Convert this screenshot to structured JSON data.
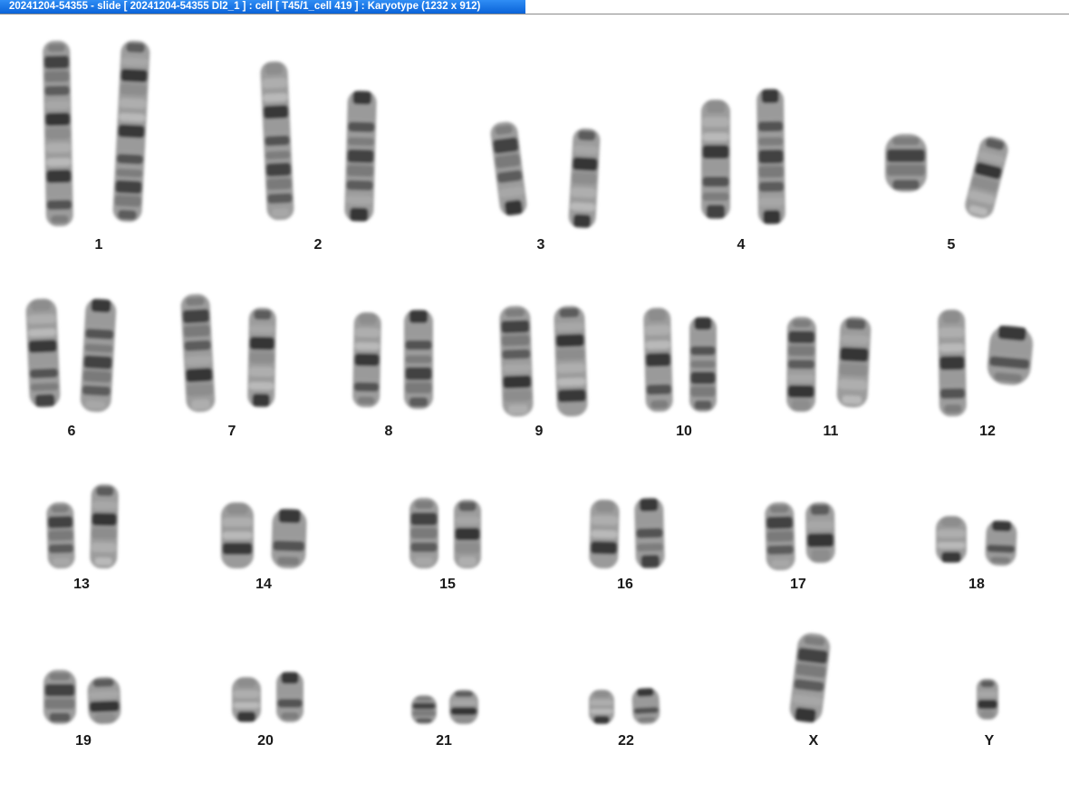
{
  "window": {
    "title": "20241204-54355 - slide [ 20241204-54355 Dl2_1 ] : cell [ T45/1_cell 419 ] : Karyotype  (1232 x 912)"
  },
  "karyotype": {
    "labels": {
      "c1": "1",
      "c2": "2",
      "c3": "3",
      "c4": "4",
      "c5": "5",
      "c6": "6",
      "c7": "7",
      "c8": "8",
      "c9": "9",
      "c10": "10",
      "c11": "11",
      "c12": "12",
      "c13": "13",
      "c14": "14",
      "c15": "15",
      "c16": "16",
      "c17": "17",
      "c18": "18",
      "c19": "19",
      "c20": "20",
      "c21": "21",
      "c22": "22",
      "cX": "X",
      "cY": "Y"
    }
  }
}
